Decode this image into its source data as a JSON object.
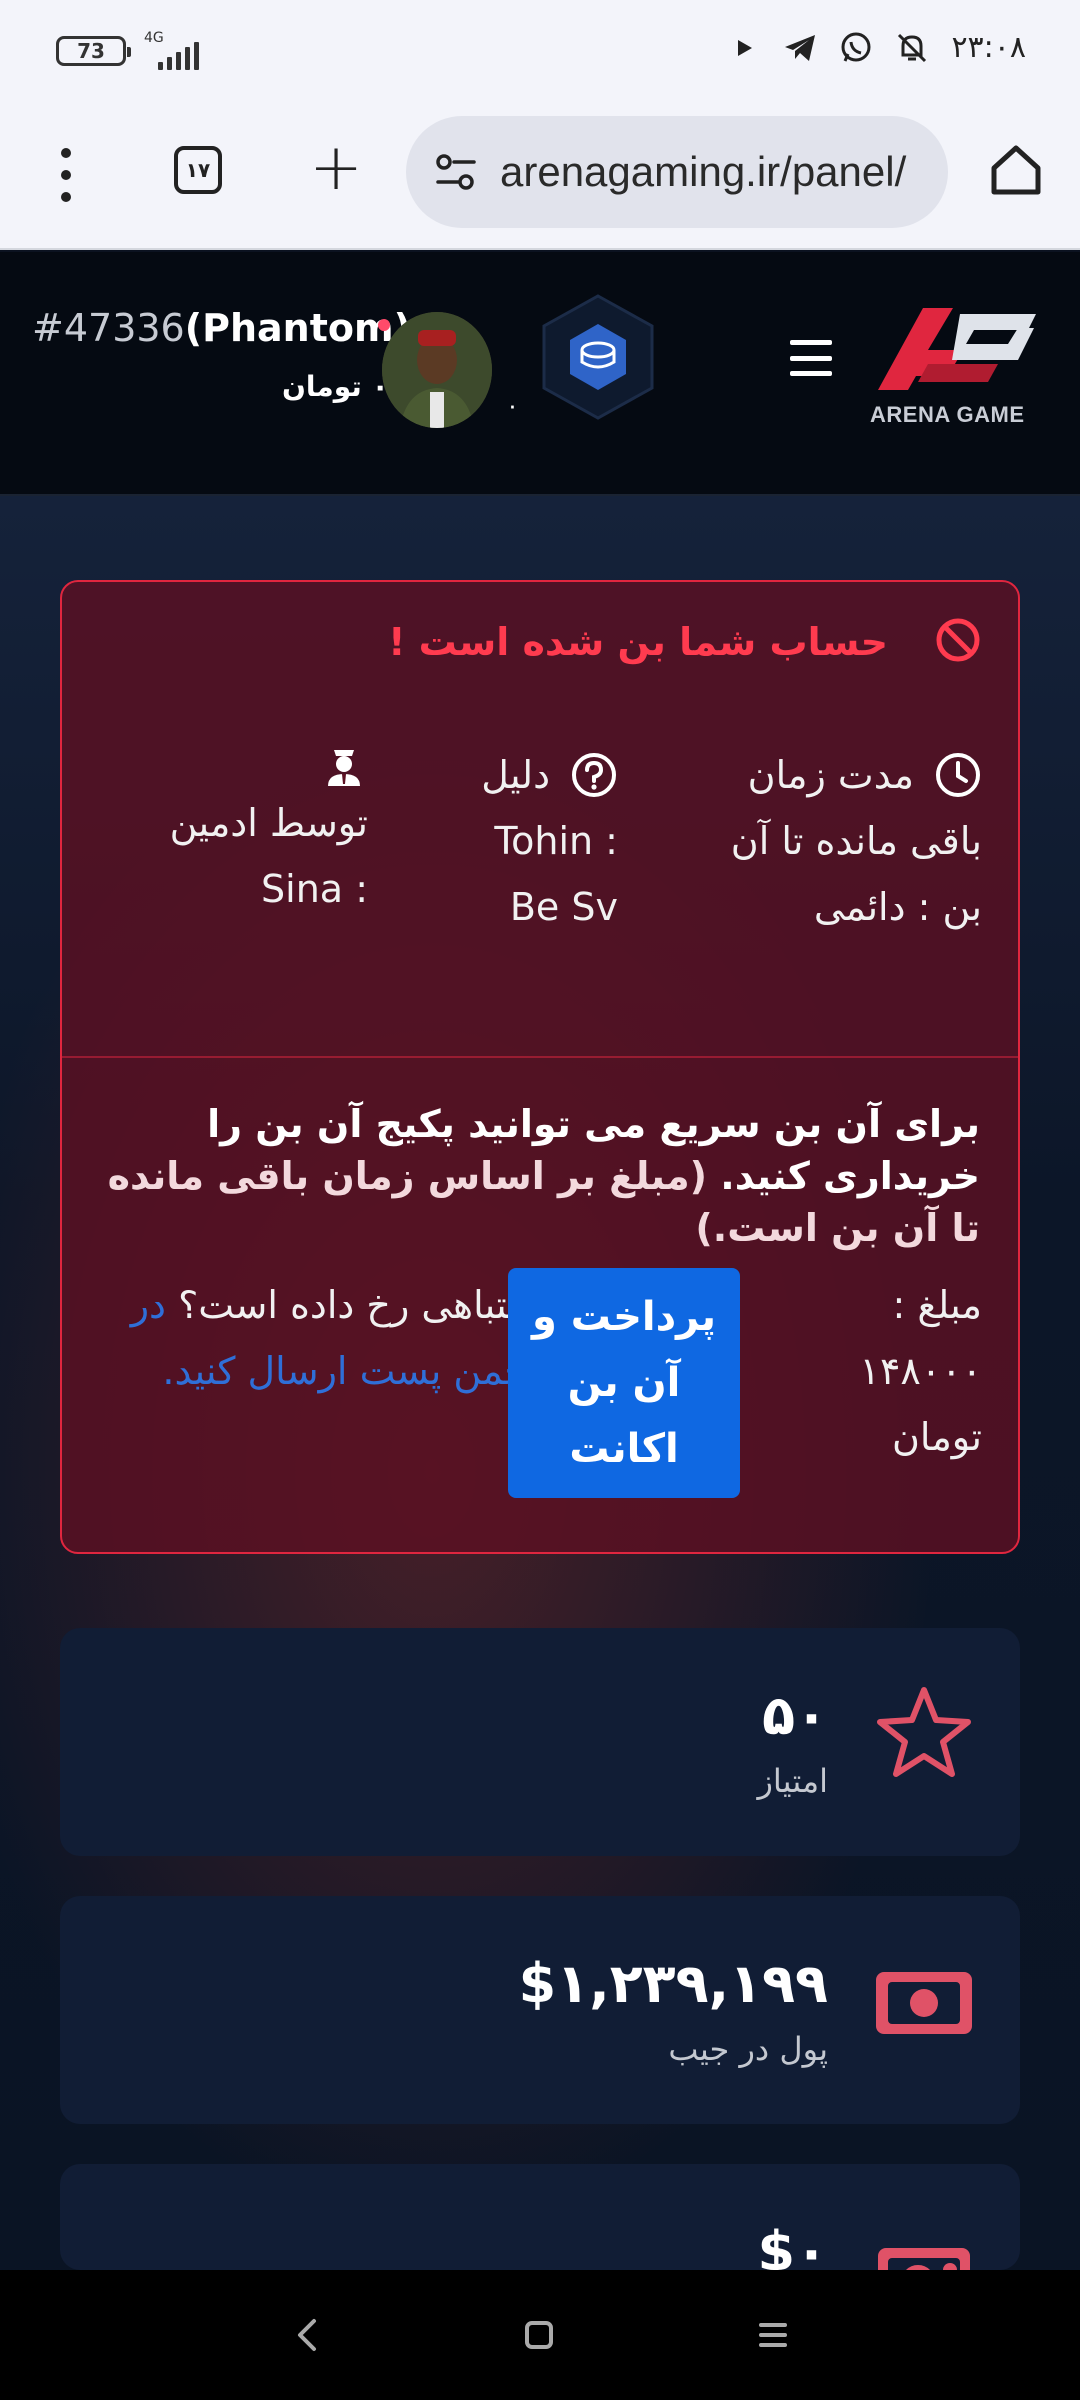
{
  "status_bar": {
    "battery": "73",
    "network": "4G",
    "time": "۲۳:۰۸"
  },
  "browser": {
    "tab_count": "۱۷",
    "url": "arenagaming.ir/panel/"
  },
  "header": {
    "user_id": "#47336",
    "username": "(Phantom)",
    "balance": "۰ تومان",
    "coin_count": "۰",
    "logo_text": "ARENA GAME",
    "brand_color": "#e0263f"
  },
  "ban": {
    "title": "حساب شما بن شده است !",
    "time_header": "مدت زمان",
    "time_value": "باقی مانده تا آن بن : دائمی",
    "reason_header": "دلیل",
    "reason_value": "Tohin : Be Sv",
    "by_value": "توسط ادمین : Sina",
    "note_main": "برای آن بن سریع می توانید پکیج آن بن را خریداری کنید.",
    "note_sub": "(مبلغ بر اساس زمان باقی مانده تا آن بن است.)",
    "amount": "مبلغ : ۱۴۸۰۰۰ تومان",
    "pay_button": "پرداخت و آن بن اکانت",
    "mistake_text": "اشتباهی رخ داده است؟",
    "mistake_link": "در انجمن پست ارسال کنید."
  },
  "stats": [
    {
      "value": "۵۰",
      "label": "امتیاز",
      "icon": "star-icon"
    },
    {
      "value": "$۱,۲۳۹,۱۹۹",
      "label": "پول در جیب",
      "icon": "cash-icon"
    },
    {
      "value": "$۰",
      "label": "",
      "icon": "bank-icon"
    }
  ]
}
